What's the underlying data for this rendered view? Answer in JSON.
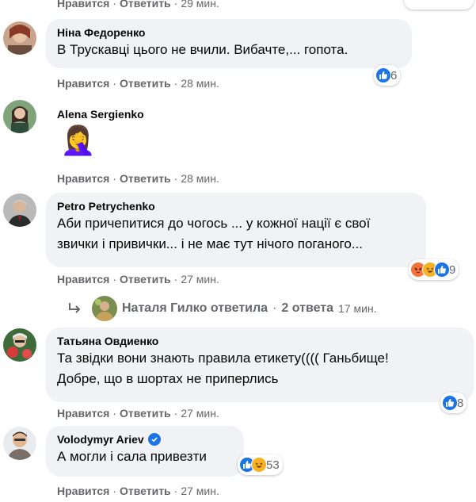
{
  "top_row": {
    "like": "Нравится",
    "reply": "Ответить",
    "time": "29 мин."
  },
  "comments": [
    {
      "author": "Ніна Федоренко",
      "text": "В Трускавці цього не вчили. Вибачте,... гопота.",
      "like": "Нравится",
      "reply": "Ответить",
      "time": "28 мин.",
      "reactions_count": "6"
    },
    {
      "author": "Alena Sergienko",
      "emoji": "🤦‍♀️",
      "like": "Нравится",
      "reply": "Ответить",
      "time": "28 мин."
    },
    {
      "author": "Petro Petrychenko",
      "text_line1": "Аби причепитися до чогось ... у кожної нації є свої",
      "text_line2": "звички і привички... і не має тут нічого поганого...",
      "like": "Нравится",
      "reply": "Ответить",
      "time": "27 мин.",
      "reactions_count": "9"
    },
    {
      "author": "Татьяна Овдиенко",
      "text_line1": "Та звідки вони знають правила етикету(((( Ганьбище!",
      "text_line2": "Добре, що в шортах не приперлись",
      "like": "Нравится",
      "reply": "Ответить",
      "time": "27 мин.",
      "reactions_count": "8"
    },
    {
      "author": "Volodymyr Ariev",
      "text": "А могли і сала привезти",
      "like": "Нравится",
      "reply": "Ответить",
      "time": "27 мин.",
      "reactions_count": "53"
    }
  ],
  "reply_link": {
    "name_action": "Наталя Гилко ответила",
    "sep": "·",
    "replies": "2 ответа",
    "time": "17 мин."
  },
  "separator": "·",
  "colors": {
    "bubble": "#f0f2f5",
    "meta_text": "#65676b",
    "like_blue": "#1b74e4",
    "angry_orange": "#f7713c",
    "haha_yellow": "#f7b125"
  },
  "icons": [
    "like-reaction-icon",
    "angry-reaction-icon",
    "haha-reaction-icon",
    "verified-badge-icon",
    "reply-arrow-icon"
  ]
}
